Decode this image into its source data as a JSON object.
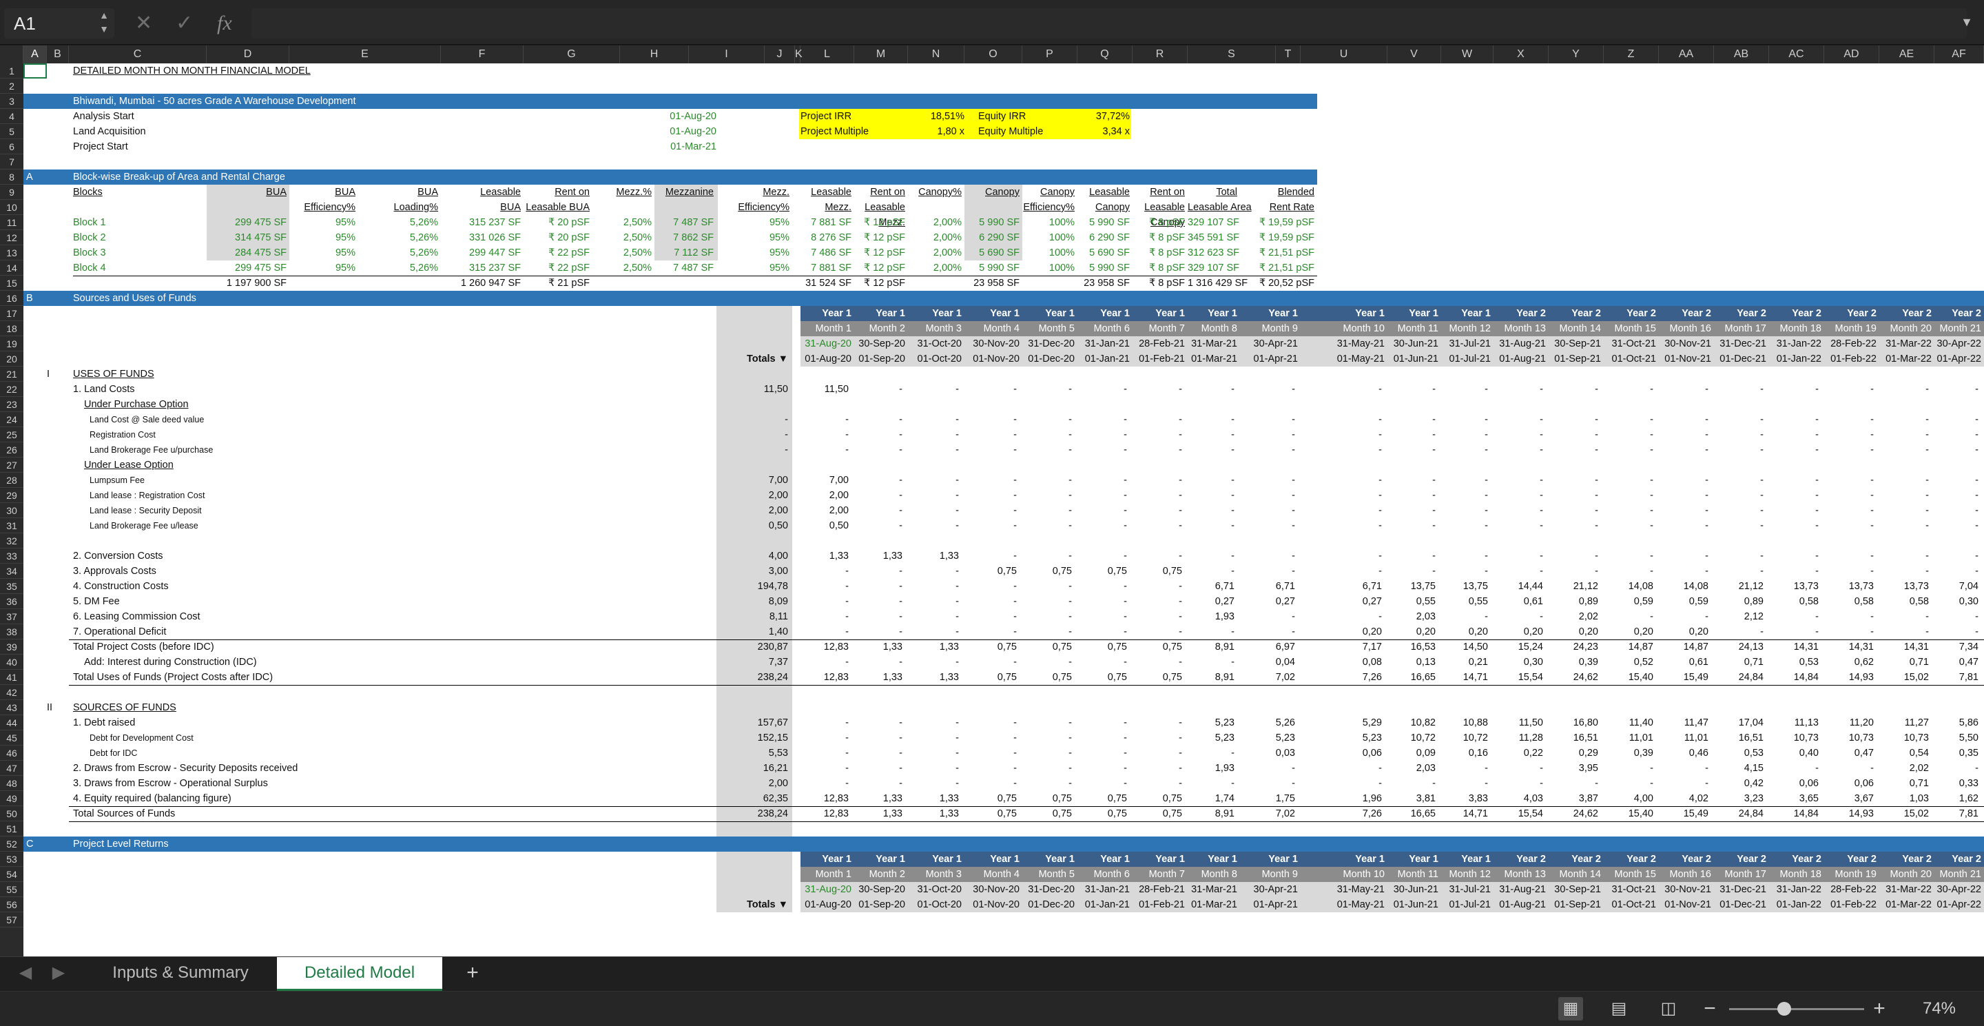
{
  "formula_bar": {
    "name_box": "A1",
    "cancel_icon": "✕",
    "enter_icon": "✓",
    "fx": "fx",
    "formula": ""
  },
  "columns": [
    "A",
    "B",
    "C",
    "D",
    "E",
    "F",
    "G",
    "H",
    "I",
    "J",
    "K",
    "L",
    "M",
    "N",
    "O",
    "P",
    "Q",
    "R",
    "S",
    "T",
    "U",
    "V",
    "W",
    "X",
    "Y",
    "Z",
    "AA",
    "AB",
    "AC",
    "AD",
    "AE",
    "AF",
    "AG"
  ],
  "rows": [
    "1",
    "2",
    "3",
    "4",
    "5",
    "6",
    "7",
    "8",
    "9",
    "10",
    "11",
    "12",
    "13",
    "14",
    "15",
    "16",
    "17",
    "18",
    "19",
    "20",
    "21",
    "22",
    "23",
    "24",
    "25",
    "26",
    "27",
    "28",
    "29",
    "30",
    "31",
    "32",
    "33",
    "34",
    "35",
    "36",
    "37",
    "38",
    "39",
    "40",
    "41",
    "42",
    "43",
    "44",
    "45",
    "46",
    "47",
    "48",
    "49",
    "50",
    "51",
    "52",
    "53",
    "54",
    "55",
    "56",
    "57"
  ],
  "model_title": "DETAILED MONTH ON MONTH FINANCIAL MODEL",
  "project_band": "Bhiwandi, Mumbai - 50 acres Grade A Warehouse Development",
  "inputs": {
    "analysis_start": {
      "label": "Analysis Start",
      "value": "01-Aug-20"
    },
    "land_acquisition": {
      "label": "Land Acquisition",
      "value": "01-Aug-20"
    },
    "project_start": {
      "label": "Project Start",
      "value": "01-Mar-21"
    }
  },
  "returns_box": {
    "project_irr_label": "Project IRR",
    "project_irr": "18,51%",
    "equity_irr_label": "Equity IRR",
    "equity_irr": "37,72%",
    "project_multiple_label": "Project Multiple",
    "project_multiple": "1,80 x",
    "equity_multiple_label": "Equity Multiple",
    "equity_multiple": "3,34 x"
  },
  "section_a": {
    "letter": "A",
    "title": "Block-wise Break-up of Area and Rental Charge"
  },
  "blocks_headers": [
    [
      "Blocks"
    ],
    [
      "BUA"
    ],
    [
      "BUA",
      "Efficiency%"
    ],
    [
      "BUA",
      "Loading%"
    ],
    [
      "Leasable",
      "BUA"
    ],
    [
      "Rent on",
      "Leasable BUA"
    ],
    [
      "Mezz.%"
    ],
    [
      "Mezzanine"
    ],
    [
      "Mezz.",
      "Efficiency%"
    ],
    [
      "Leasable",
      "Mezz."
    ],
    [
      "Rent on",
      "Leasable",
      "Mezz."
    ],
    [
      "Canopy%"
    ],
    [
      "Canopy"
    ],
    [
      "Canopy",
      "Efficiency%"
    ],
    [
      "Leasable",
      "Canopy"
    ],
    [
      "Rent on",
      "Leasable",
      "Canopy"
    ],
    [
      "Total",
      "Leasable Area"
    ],
    [
      "Blended",
      "Rent Rate"
    ]
  ],
  "blocks": [
    [
      "Block 1",
      "299 475 SF",
      "95%",
      "5,26%",
      "315 237 SF",
      "₹ 20 pSF",
      "2,50%",
      "7 487 SF",
      "95%",
      "7 881 SF",
      "₹ 12 pSF",
      "2,00%",
      "5 990 SF",
      "100%",
      "5 990 SF",
      "₹ 8 pSF",
      "329 107 SF",
      "₹ 19,59 pSF"
    ],
    [
      "Block 2",
      "314 475 SF",
      "95%",
      "5,26%",
      "331 026 SF",
      "₹ 20 pSF",
      "2,50%",
      "7 862 SF",
      "95%",
      "8 276 SF",
      "₹ 12 pSF",
      "2,00%",
      "6 290 SF",
      "100%",
      "6 290 SF",
      "₹ 8 pSF",
      "345 591 SF",
      "₹ 19,59 pSF"
    ],
    [
      "Block 3",
      "284 475 SF",
      "95%",
      "5,26%",
      "299 447 SF",
      "₹ 22 pSF",
      "2,50%",
      "7 112 SF",
      "95%",
      "7 486 SF",
      "₹ 12 pSF",
      "2,00%",
      "5 690 SF",
      "100%",
      "5 690 SF",
      "₹ 8 pSF",
      "312 623 SF",
      "₹ 21,51 pSF"
    ],
    [
      "Block 4",
      "299 475 SF",
      "95%",
      "5,26%",
      "315 237 SF",
      "₹ 22 pSF",
      "2,50%",
      "7 487 SF",
      "95%",
      "7 881 SF",
      "₹ 12 pSF",
      "2,00%",
      "5 990 SF",
      "100%",
      "5 990 SF",
      "₹ 8 pSF",
      "329 107 SF",
      "₹ 21,51 pSF"
    ]
  ],
  "blocks_total": [
    "",
    "1 197 900 SF",
    "",
    "",
    "1 260 947 SF",
    "₹ 21 pSF",
    "",
    "",
    "",
    "31 524 SF",
    "₹ 12 pSF",
    "",
    "23 958 SF",
    "",
    "23 958 SF",
    "₹ 8 pSF",
    "1 316 429 SF",
    "₹ 20,52 pSF"
  ],
  "section_b": {
    "letter": "B",
    "title": "Sources and Uses of Funds"
  },
  "timeline": {
    "years": [
      "Year 1",
      "Year 1",
      "Year 1",
      "Year 1",
      "Year 1",
      "Year 1",
      "Year 1",
      "Year 1",
      "Year 1",
      "Year 1",
      "Year 1",
      "Year 1",
      "Year 2",
      "Year 2",
      "Year 2",
      "Year 2",
      "Year 2",
      "Year 2",
      "Year 2",
      "Year 2",
      "Year 2"
    ],
    "months": [
      "Month 1",
      "Month 2",
      "Month 3",
      "Month 4",
      "Month 5",
      "Month 6",
      "Month 7",
      "Month 8",
      "Month 9",
      "Month 10",
      "Month 11",
      "Month 12",
      "Month 13",
      "Month 14",
      "Month 15",
      "Month 16",
      "Month 17",
      "Month 18",
      "Month 19",
      "Month 20",
      "Month 21"
    ],
    "end_dates": [
      "31-Aug-20",
      "30-Sep-20",
      "31-Oct-20",
      "30-Nov-20",
      "31-Dec-20",
      "31-Jan-21",
      "28-Feb-21",
      "31-Mar-21",
      "30-Apr-21",
      "31-May-21",
      "30-Jun-21",
      "31-Jul-21",
      "31-Aug-21",
      "30-Sep-21",
      "31-Oct-21",
      "30-Nov-21",
      "31-Dec-21",
      "31-Jan-22",
      "28-Feb-22",
      "31-Mar-22",
      "30-Apr-22"
    ],
    "start_dates": [
      "01-Aug-20",
      "01-Sep-20",
      "01-Oct-20",
      "01-Nov-20",
      "01-Dec-20",
      "01-Jan-21",
      "01-Feb-21",
      "01-Mar-21",
      "01-Apr-21",
      "01-May-21",
      "01-Jun-21",
      "01-Jul-21",
      "01-Aug-21",
      "01-Sep-21",
      "01-Oct-21",
      "01-Nov-21",
      "01-Dec-21",
      "01-Jan-22",
      "01-Feb-22",
      "01-Mar-22",
      "01-Apr-22"
    ],
    "totals_label": "Totals ▼"
  },
  "uses": {
    "roman": "I",
    "title": "USES OF FUNDS",
    "lines": [
      {
        "r": 22,
        "label": "1. Land Costs",
        "indent": 0,
        "total": "11,50",
        "vals": [
          "11,50",
          "-",
          "-",
          "-",
          "-",
          "-",
          "-",
          "-",
          "-",
          "-",
          "-",
          "-",
          "-",
          "-",
          "-",
          "-",
          "-",
          "-",
          "-",
          "-",
          "-"
        ]
      },
      {
        "r": 23,
        "label": "Under Purchase Option",
        "indent": 1,
        "style": "u"
      },
      {
        "r": 24,
        "label": "Land Cost @ Sale deed value",
        "indent": 2,
        "total": "-",
        "vals": [
          "-",
          "-",
          "-",
          "-",
          "-",
          "-",
          "-",
          "-",
          "-",
          "-",
          "-",
          "-",
          "-",
          "-",
          "-",
          "-",
          "-",
          "-",
          "-",
          "-",
          "-"
        ]
      },
      {
        "r": 25,
        "label": "Registration Cost",
        "indent": 2,
        "total": "-",
        "vals": [
          "-",
          "-",
          "-",
          "-",
          "-",
          "-",
          "-",
          "-",
          "-",
          "-",
          "-",
          "-",
          "-",
          "-",
          "-",
          "-",
          "-",
          "-",
          "-",
          "-",
          "-"
        ]
      },
      {
        "r": 26,
        "label": "Land Brokerage Fee u/purchase",
        "indent": 2,
        "total": "-",
        "vals": [
          "-",
          "-",
          "-",
          "-",
          "-",
          "-",
          "-",
          "-",
          "-",
          "-",
          "-",
          "-",
          "-",
          "-",
          "-",
          "-",
          "-",
          "-",
          "-",
          "-",
          "-"
        ]
      },
      {
        "r": 27,
        "label": "Under Lease Option",
        "indent": 1,
        "style": "u"
      },
      {
        "r": 28,
        "label": "Lumpsum Fee",
        "indent": 2,
        "total": "7,00",
        "vals": [
          "7,00",
          "-",
          "-",
          "-",
          "-",
          "-",
          "-",
          "-",
          "-",
          "-",
          "-",
          "-",
          "-",
          "-",
          "-",
          "-",
          "-",
          "-",
          "-",
          "-",
          "-"
        ]
      },
      {
        "r": 29,
        "label": "Land lease : Registration Cost",
        "indent": 2,
        "total": "2,00",
        "vals": [
          "2,00",
          "-",
          "-",
          "-",
          "-",
          "-",
          "-",
          "-",
          "-",
          "-",
          "-",
          "-",
          "-",
          "-",
          "-",
          "-",
          "-",
          "-",
          "-",
          "-",
          "-"
        ]
      },
      {
        "r": 30,
        "label": "Land lease : Security Deposit",
        "indent": 2,
        "total": "2,00",
        "vals": [
          "2,00",
          "-",
          "-",
          "-",
          "-",
          "-",
          "-",
          "-",
          "-",
          "-",
          "-",
          "-",
          "-",
          "-",
          "-",
          "-",
          "-",
          "-",
          "-",
          "-",
          "-"
        ]
      },
      {
        "r": 31,
        "label": "Land Brokerage Fee u/lease",
        "indent": 2,
        "total": "0,50",
        "vals": [
          "0,50",
          "-",
          "-",
          "-",
          "-",
          "-",
          "-",
          "-",
          "-",
          "-",
          "-",
          "-",
          "-",
          "-",
          "-",
          "-",
          "-",
          "-",
          "-",
          "-",
          "-"
        ]
      },
      {
        "r": 33,
        "label": "2. Conversion Costs",
        "indent": 0,
        "total": "4,00",
        "vals": [
          "1,33",
          "1,33",
          "1,33",
          "-",
          "-",
          "-",
          "-",
          "-",
          "-",
          "-",
          "-",
          "-",
          "-",
          "-",
          "-",
          "-",
          "-",
          "-",
          "-",
          "-",
          "-"
        ]
      },
      {
        "r": 34,
        "label": "3. Approvals Costs",
        "indent": 0,
        "total": "3,00",
        "vals": [
          "-",
          "-",
          "-",
          "0,75",
          "0,75",
          "0,75",
          "0,75",
          "-",
          "-",
          "-",
          "-",
          "-",
          "-",
          "-",
          "-",
          "-",
          "-",
          "-",
          "-",
          "-",
          "-"
        ]
      },
      {
        "r": 35,
        "label": "4. Construction Costs",
        "indent": 0,
        "total": "194,78",
        "vals": [
          "-",
          "-",
          "-",
          "-",
          "-",
          "-",
          "-",
          "6,71",
          "6,71",
          "6,71",
          "13,75",
          "13,75",
          "14,44",
          "21,12",
          "14,08",
          "14,08",
          "21,12",
          "13,73",
          "13,73",
          "13,73",
          "7,04"
        ]
      },
      {
        "r": 36,
        "label": "5. DM Fee",
        "indent": 0,
        "total": "8,09",
        "vals": [
          "-",
          "-",
          "-",
          "-",
          "-",
          "-",
          "-",
          "0,27",
          "0,27",
          "0,27",
          "0,55",
          "0,55",
          "0,61",
          "0,89",
          "0,59",
          "0,59",
          "0,89",
          "0,58",
          "0,58",
          "0,58",
          "0,30"
        ]
      },
      {
        "r": 37,
        "label": "6. Leasing Commission Cost",
        "indent": 0,
        "total": "8,11",
        "vals": [
          "-",
          "-",
          "-",
          "-",
          "-",
          "-",
          "-",
          "1,93",
          "-",
          "-",
          "2,03",
          "-",
          "-",
          "2,02",
          "-",
          "-",
          "2,12",
          "-",
          "-",
          "-",
          "-"
        ]
      },
      {
        "r": 38,
        "label": "7. Operational Deficit",
        "indent": 0,
        "total": "1,40",
        "vals": [
          "-",
          "-",
          "-",
          "-",
          "-",
          "-",
          "-",
          "-",
          "-",
          "0,20",
          "0,20",
          "0,20",
          "0,20",
          "0,20",
          "0,20",
          "0,20",
          "-",
          "-",
          "-",
          "-",
          "-"
        ]
      },
      {
        "r": 39,
        "label": "Total Project Costs (before IDC)",
        "indent": 0,
        "total": "230,87",
        "vals": [
          "12,83",
          "1,33",
          "1,33",
          "0,75",
          "0,75",
          "0,75",
          "0,75",
          "8,91",
          "6,97",
          "7,17",
          "16,53",
          "14,50",
          "15,24",
          "24,23",
          "14,87",
          "14,87",
          "24,13",
          "14,31",
          "14,31",
          "14,31",
          "7,34"
        ]
      },
      {
        "r": 40,
        "label": "Add: Interest during Construction (IDC)",
        "indent": 1,
        "total": "7,37",
        "vals": [
          "-",
          "-",
          "-",
          "-",
          "-",
          "-",
          "-",
          "-",
          "0,04",
          "0,08",
          "0,13",
          "0,21",
          "0,30",
          "0,39",
          "0,52",
          "0,61",
          "0,71",
          "0,53",
          "0,62",
          "0,71",
          "0,47"
        ]
      },
      {
        "r": 41,
        "label": "Total Uses of Funds (Project Costs after IDC)",
        "indent": 0,
        "total": "238,24",
        "vals": [
          "12,83",
          "1,33",
          "1,33",
          "0,75",
          "0,75",
          "0,75",
          "0,75",
          "8,91",
          "7,02",
          "7,26",
          "16,65",
          "14,71",
          "15,54",
          "24,62",
          "15,40",
          "15,49",
          "24,84",
          "14,84",
          "14,93",
          "15,02",
          "7,81"
        ]
      }
    ]
  },
  "sources": {
    "roman": "II",
    "title": "SOURCES OF FUNDS",
    "lines": [
      {
        "r": 44,
        "label": "1. Debt raised",
        "indent": 0,
        "total": "157,67",
        "vals": [
          "-",
          "-",
          "-",
          "-",
          "-",
          "-",
          "-",
          "5,23",
          "5,26",
          "5,29",
          "10,82",
          "10,88",
          "11,50",
          "16,80",
          "11,40",
          "11,47",
          "17,04",
          "11,13",
          "11,20",
          "11,27",
          "5,86"
        ]
      },
      {
        "r": 45,
        "label": "Debt for Development Cost",
        "indent": 2,
        "total": "152,15",
        "vals": [
          "-",
          "-",
          "-",
          "-",
          "-",
          "-",
          "-",
          "5,23",
          "5,23",
          "5,23",
          "10,72",
          "10,72",
          "11,28",
          "16,51",
          "11,01",
          "11,01",
          "16,51",
          "10,73",
          "10,73",
          "10,73",
          "5,50"
        ]
      },
      {
        "r": 46,
        "label": "Debt for IDC",
        "indent": 2,
        "total": "5,53",
        "vals": [
          "-",
          "-",
          "-",
          "-",
          "-",
          "-",
          "-",
          "-",
          "0,03",
          "0,06",
          "0,09",
          "0,16",
          "0,22",
          "0,29",
          "0,39",
          "0,46",
          "0,53",
          "0,40",
          "0,47",
          "0,54",
          "0,35"
        ]
      },
      {
        "r": 47,
        "label": "2. Draws from  Escrow - Security Deposits received",
        "indent": 0,
        "total": "16,21",
        "vals": [
          "-",
          "-",
          "-",
          "-",
          "-",
          "-",
          "-",
          "1,93",
          "-",
          "-",
          "2,03",
          "-",
          "-",
          "3,95",
          "-",
          "-",
          "4,15",
          "-",
          "-",
          "2,02",
          "-"
        ]
      },
      {
        "r": 48,
        "label": "3. Draws from Escrow - Operational Surplus",
        "indent": 0,
        "total": "2,00",
        "vals": [
          "-",
          "-",
          "-",
          "-",
          "-",
          "-",
          "-",
          "-",
          "-",
          "-",
          "-",
          "-",
          "-",
          "-",
          "-",
          "-",
          "0,42",
          "0,06",
          "0,06",
          "0,71",
          "0,33"
        ]
      },
      {
        "r": 49,
        "label": "4. Equity required (balancing figure)",
        "indent": 0,
        "total": "62,35",
        "vals": [
          "12,83",
          "1,33",
          "1,33",
          "0,75",
          "0,75",
          "0,75",
          "0,75",
          "1,74",
          "1,75",
          "1,96",
          "3,81",
          "3,83",
          "4,03",
          "3,87",
          "4,00",
          "4,02",
          "3,23",
          "3,65",
          "3,67",
          "1,03",
          "1,62"
        ]
      },
      {
        "r": 50,
        "label": "Total Sources of Funds",
        "indent": 0,
        "total": "238,24",
        "vals": [
          "12,83",
          "1,33",
          "1,33",
          "0,75",
          "0,75",
          "0,75",
          "0,75",
          "8,91",
          "7,02",
          "7,26",
          "16,65",
          "14,71",
          "15,54",
          "24,62",
          "15,40",
          "15,49",
          "24,84",
          "14,84",
          "14,93",
          "15,02",
          "7,81"
        ]
      }
    ]
  },
  "section_c": {
    "letter": "C",
    "title": "Project Level Returns"
  },
  "sheet_tabs": {
    "tab1": "Inputs & Summary",
    "tab2": "Detailed Model",
    "add": "+"
  },
  "status_bar": {
    "zoom": "74%",
    "minus": "−",
    "plus": "+"
  },
  "colors": {
    "band": "#2e75b6",
    "accent_green": "#1e7b45",
    "input_green": "#2a8a2a",
    "highlight": "#ffff00"
  }
}
